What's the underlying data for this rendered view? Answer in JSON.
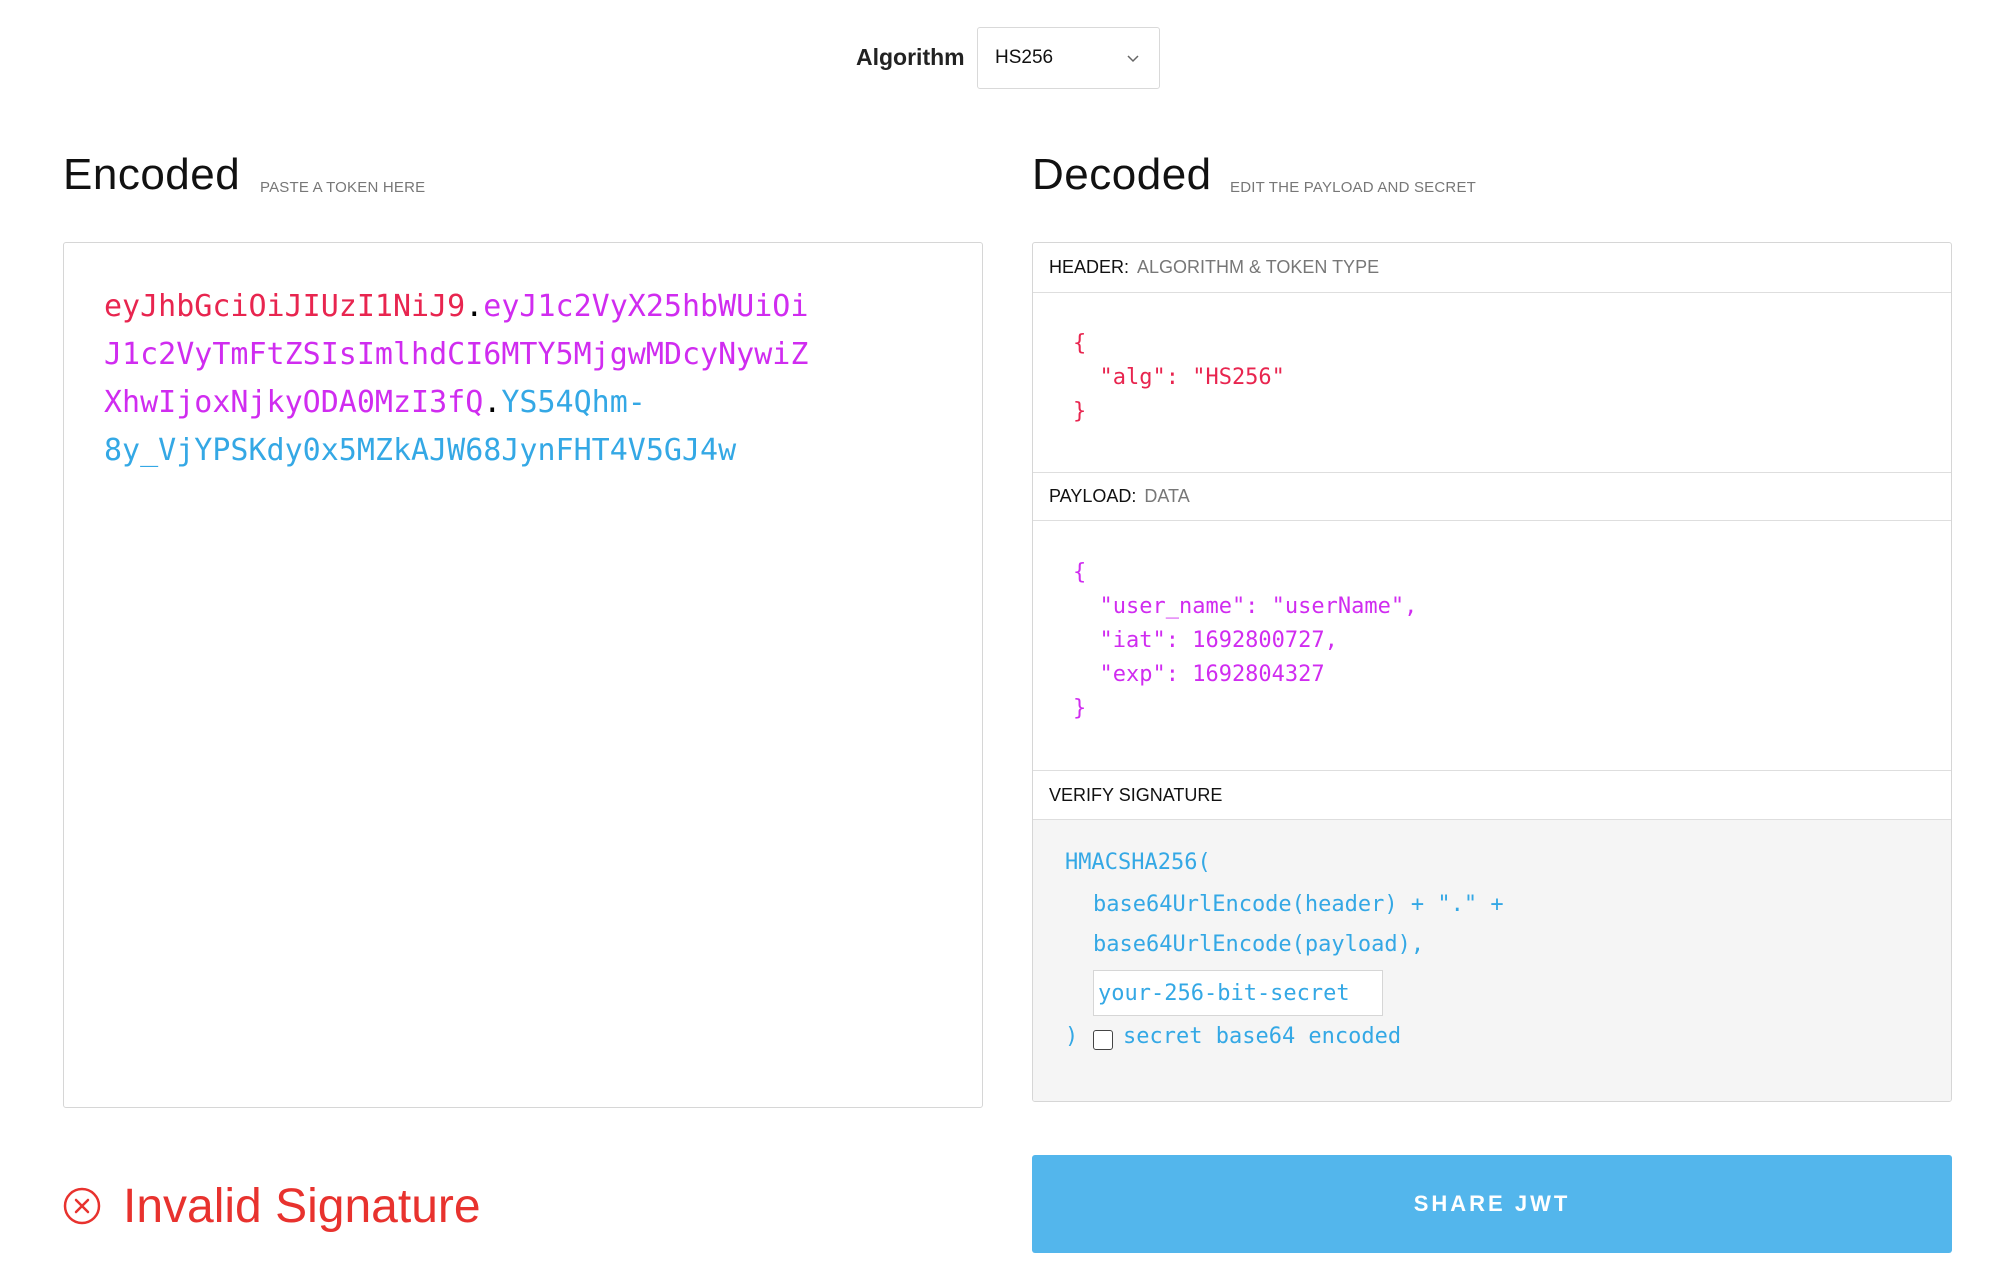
{
  "algorithm": {
    "label": "Algorithm",
    "selected": "HS256"
  },
  "encoded": {
    "title": "Encoded",
    "subtitle": "PASTE A TOKEN HERE",
    "token_lines": [
      {
        "header": "eyJhbGciOiJIUzI1NiJ9",
        "dot": ".",
        "payload": "eyJ1c2VyX25hbWUiOi"
      },
      {
        "payload": "J1c2VyTmFtZSIsImlhdCI6MTY5MjgwMDcyNywiZ"
      },
      {
        "payload": "XhwIjoxNjkyODA0MzI3fQ",
        "dot": ".",
        "signature": "YS54Qhm-"
      },
      {
        "signature": "8y_VjYPSKdy0x5MZkAJW68JynFHT4V5GJ4w"
      }
    ]
  },
  "decoded": {
    "title": "Decoded",
    "subtitle": "EDIT THE PAYLOAD AND SECRET",
    "header_section": {
      "label": "HEADER:",
      "desc": "ALGORITHM & TOKEN TYPE",
      "lines": [
        "{",
        "  \"alg\": \"HS256\"",
        "}"
      ]
    },
    "payload_section": {
      "label": "PAYLOAD:",
      "desc": "DATA",
      "lines": [
        "{",
        "  \"user_name\": \"userName\",",
        "  \"iat\": 1692800727,",
        "  \"exp\": 1692804327",
        "}"
      ]
    },
    "verify_section": {
      "label": "VERIFY SIGNATURE",
      "fn_open": "HMACSHA256(",
      "line1": "base64UrlEncode(header) + \".\" +",
      "line2": "base64UrlEncode(payload),",
      "secret_placeholder": "your-256-bit-secret",
      "close": ")",
      "checkbox_label": "secret base64 encoded"
    }
  },
  "status": {
    "text": "Invalid Signature"
  },
  "share": {
    "label": "SHARE JWT"
  },
  "colors": {
    "header": "#e8254f",
    "payload": "#d02cf0",
    "signature": "#34a8e5",
    "error": "#e8322e",
    "share_button": "#53b6ec"
  }
}
